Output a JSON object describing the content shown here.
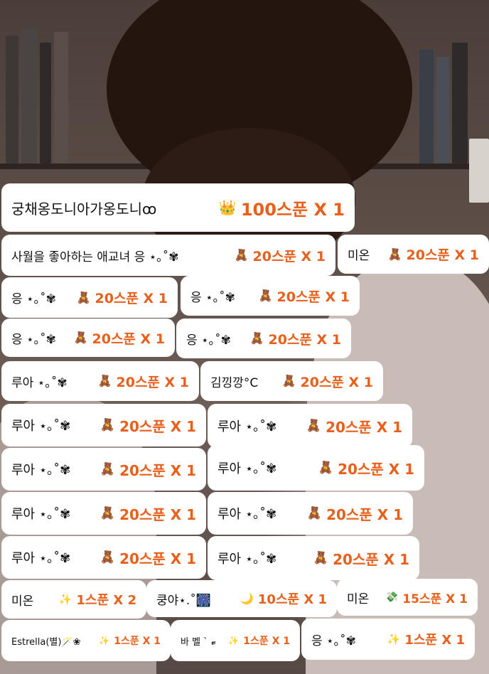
{
  "donations": [
    {
      "id": "d1",
      "name": "궁채옹도니아가옹도니ꝏ",
      "gift_icon": "crown-icon",
      "gift_glyph": "👑",
      "amount": "100스푼 X 1"
    },
    {
      "id": "d2",
      "name": "사월을 좋아하는 애교녀 응 ⋆｡˚✾",
      "gift_icon": "bear-icon",
      "gift_glyph": "🧸",
      "amount": "20스푼 X 1"
    },
    {
      "id": "d3",
      "name": "미온",
      "gift_icon": "bear-icon",
      "gift_glyph": "🧸",
      "amount": "20스푼 X 1"
    },
    {
      "id": "d4",
      "name": "응 ⋆｡˚✾",
      "gift_icon": "bear-icon",
      "gift_glyph": "🧸",
      "amount": "20스푼 X 1"
    },
    {
      "id": "d5",
      "name": "응 ⋆｡˚✾",
      "gift_icon": "bear-icon",
      "gift_glyph": "🧸",
      "amount": "20스푼 X 1"
    },
    {
      "id": "d6",
      "name": "응 ⋆｡˚✾",
      "gift_icon": "bear-icon",
      "gift_glyph": "🧸",
      "amount": "20스푼 X 1"
    },
    {
      "id": "d7",
      "name": "응 ⋆｡˚✾",
      "gift_icon": "bear-icon",
      "gift_glyph": "🧸",
      "amount": "20스푼 X 1"
    },
    {
      "id": "d8",
      "name": "루아 ⋆｡˚✾",
      "gift_icon": "bear-icon",
      "gift_glyph": "🧸",
      "amount": "20스푼 X 1"
    },
    {
      "id": "d9",
      "name": "김낑깡°C",
      "gift_icon": "bear-icon",
      "gift_glyph": "🧸",
      "amount": "20스푼 X 1"
    },
    {
      "id": "d10",
      "name": "루아 ⋆｡˚✾",
      "gift_icon": "bear-icon",
      "gift_glyph": "🧸",
      "amount": "20스푼 X 1"
    },
    {
      "id": "d11",
      "name": "루아 ⋆｡˚✾",
      "gift_icon": "bear-icon",
      "gift_glyph": "🧸",
      "amount": "20스푼 X 1"
    },
    {
      "id": "d12",
      "name": "루아 ⋆｡˚✾",
      "gift_icon": "bear-icon",
      "gift_glyph": "🧸",
      "amount": "20스푼 X 1"
    },
    {
      "id": "d13",
      "name": "루아 ⋆｡˚✾",
      "gift_icon": "bear-icon",
      "gift_glyph": "🧸",
      "amount": "20스푼 X 1"
    },
    {
      "id": "d14",
      "name": "루아 ⋆｡˚✾",
      "gift_icon": "bear-icon",
      "gift_glyph": "🧸",
      "amount": "20스푼 X 1"
    },
    {
      "id": "d15",
      "name": "루아 ⋆｡˚✾",
      "gift_icon": "bear-icon",
      "gift_glyph": "🧸",
      "amount": "20스푼 X 1"
    },
    {
      "id": "d16",
      "name": "루아 ⋆｡˚✾",
      "gift_icon": "bear-icon",
      "gift_glyph": "🧸",
      "amount": "20스푼 X 1"
    },
    {
      "id": "d17",
      "name": "루아 ⋆｡˚✾",
      "gift_icon": "bear-icon",
      "gift_glyph": "🧸",
      "amount": "20스푼 X 1"
    },
    {
      "id": "d18",
      "name": "미온",
      "gift_icon": "sparkle-wand-icon",
      "gift_glyph": "✨",
      "amount": "1스푼 X 2"
    },
    {
      "id": "d19",
      "name": "쿵야⋆.˚🎆",
      "gift_icon": "moon-icon",
      "gift_glyph": "🌙",
      "amount": "10스푼 X 1"
    },
    {
      "id": "d20",
      "name": "미온",
      "gift_icon": "money-icon",
      "gift_glyph": "💸",
      "amount": "15스푼 X 1"
    },
    {
      "id": "d21",
      "name": "Estrella(별)🪄❀",
      "gift_icon": "sparkle-wand-icon",
      "gift_glyph": "✨",
      "amount": "1스푼 X 1"
    },
    {
      "id": "d22",
      "name": "바 벨 ˋ 𝓿",
      "gift_icon": "sparkle-wand-icon",
      "gift_glyph": "✨",
      "amount": "1스푼 X 1"
    },
    {
      "id": "d23",
      "name": "응 ⋆｡˚✾",
      "gift_icon": "sparkle-wand-icon",
      "gift_glyph": "✨",
      "amount": "1스푼 X 1"
    }
  ]
}
